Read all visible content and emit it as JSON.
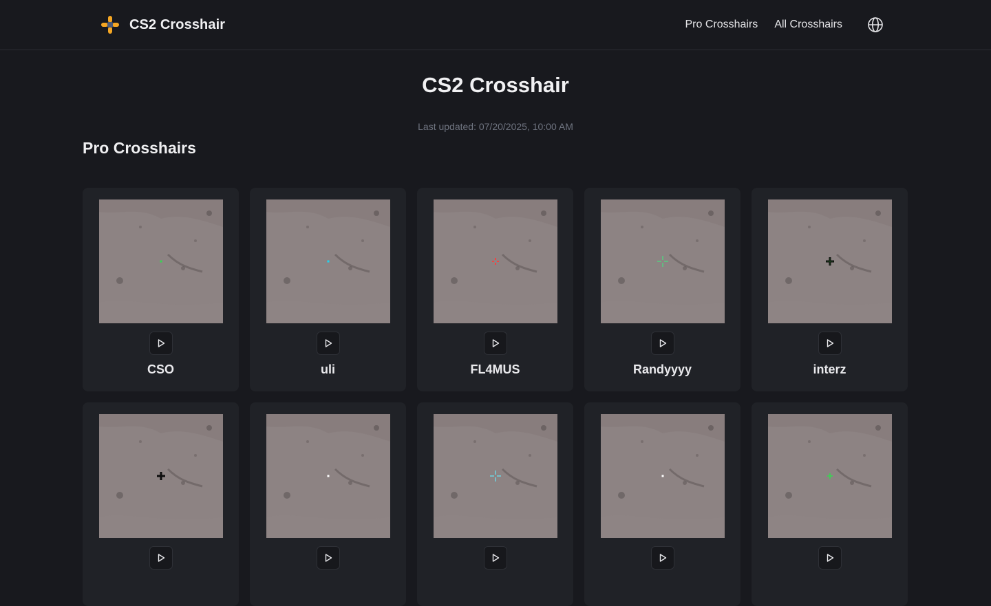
{
  "nav": {
    "brand": "CS2 Crosshair",
    "links": [
      "Pro Crosshairs",
      "All Crosshairs"
    ],
    "language_icon": "globe-icon"
  },
  "hero": {
    "title": "CS2 Crosshair",
    "updated": "Last updated: 07/20/2025, 10:00 AM"
  },
  "section": {
    "title": "Pro Crosshairs"
  },
  "cards": [
    {
      "name": "CSO",
      "crosshair_color": "#39d353",
      "style": "dot-small"
    },
    {
      "name": "uli",
      "crosshair_color": "#22d3ee",
      "style": "dot-small"
    },
    {
      "name": "FL4MUS",
      "crosshair_color": "#ef4444",
      "style": "cross-gap"
    },
    {
      "name": "Randyyyy",
      "crosshair_color": "#4ade80",
      "style": "cross-large"
    },
    {
      "name": "interz",
      "crosshair_color": "#1f3d1f",
      "style": "cross-outline"
    },
    {
      "name": "",
      "crosshair_color": "#111111",
      "style": "cross-outline"
    },
    {
      "name": "",
      "crosshair_color": "#ffffff",
      "style": "dot-small"
    },
    {
      "name": "",
      "crosshair_color": "#67e8f9",
      "style": "cross-large"
    },
    {
      "name": "",
      "crosshair_color": "#ffffff",
      "style": "dot-small"
    },
    {
      "name": "",
      "crosshair_color": "#39d353",
      "style": "cross-small"
    }
  ],
  "icons": {
    "play": "play-icon",
    "logo": "crosshair-logo-icon"
  }
}
